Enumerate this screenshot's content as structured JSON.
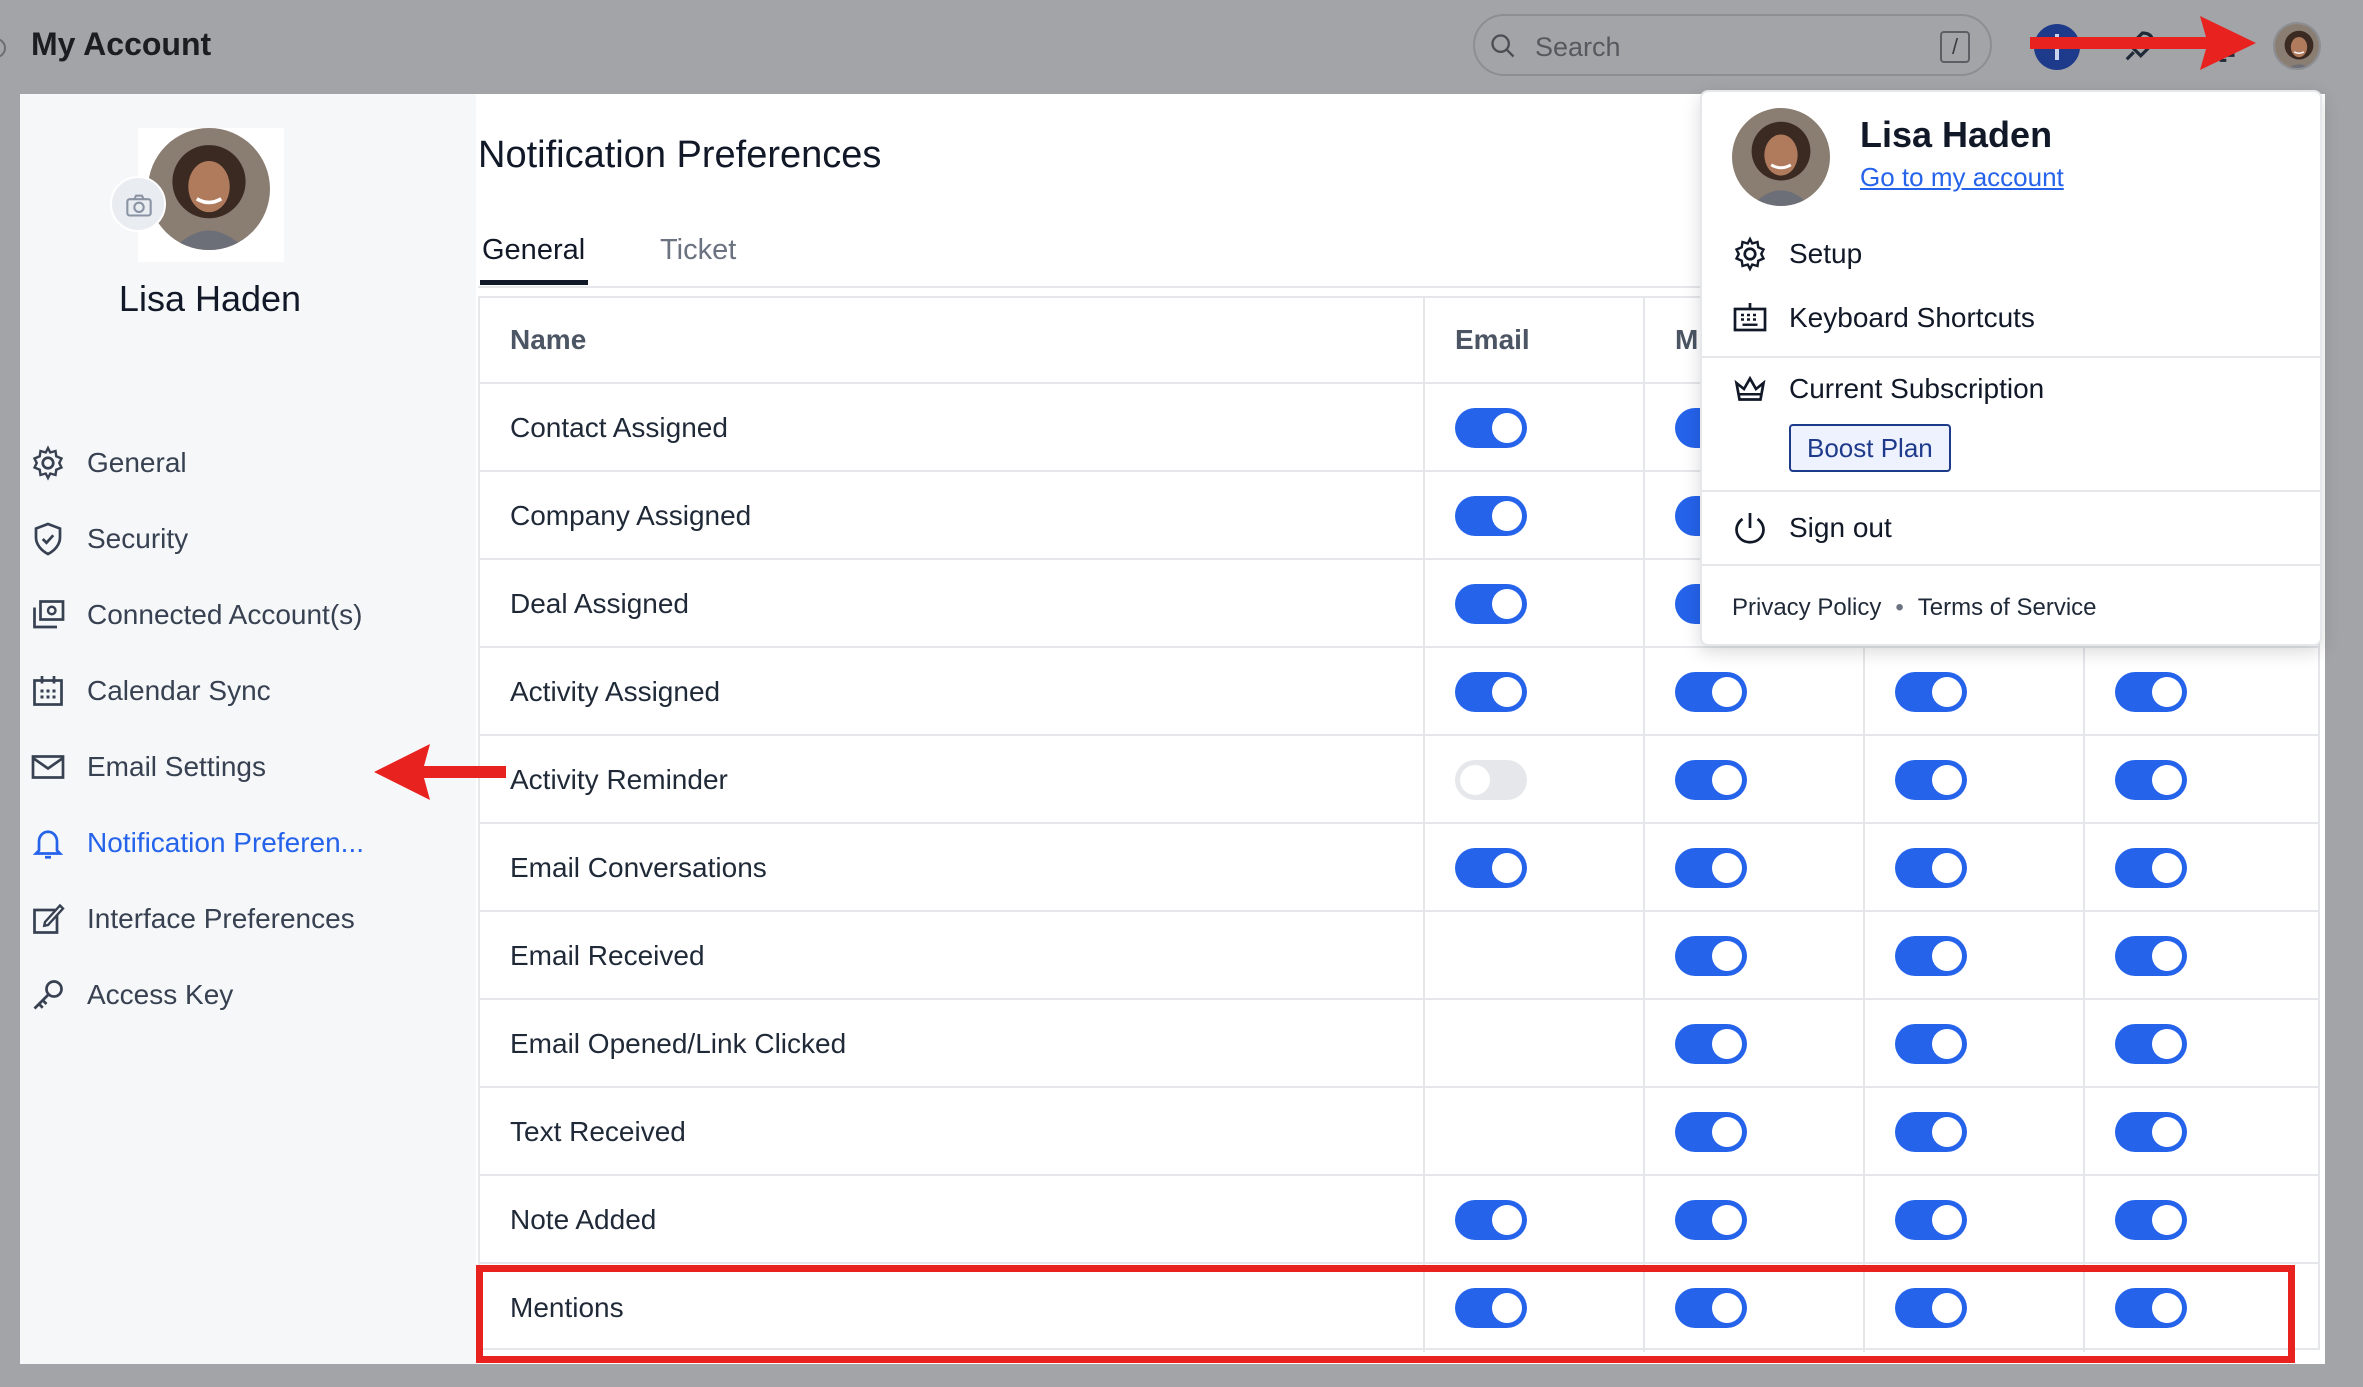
{
  "header": {
    "title": "My Account",
    "search_placeholder": "Search",
    "search_shortcut": "/"
  },
  "profile": {
    "name": "Lisa Haden"
  },
  "sidebar": {
    "items": [
      {
        "label": "General",
        "icon": "gear-icon"
      },
      {
        "label": "Security",
        "icon": "shield-icon"
      },
      {
        "label": "Connected Account(s)",
        "icon": "connected-accounts-icon"
      },
      {
        "label": "Calendar Sync",
        "icon": "calendar-icon"
      },
      {
        "label": "Email Settings",
        "icon": "mail-icon"
      },
      {
        "label": "Notification Preferen...",
        "icon": "bell-icon",
        "active": true
      },
      {
        "label": "Interface Preferences",
        "icon": "edit-icon"
      },
      {
        "label": "Access Key",
        "icon": "key-icon"
      }
    ]
  },
  "main": {
    "title": "Notification Preferences",
    "tabs": [
      {
        "label": "General",
        "active": true
      },
      {
        "label": "Ticket",
        "active": false
      }
    ],
    "table": {
      "columns": [
        "Name",
        "Email",
        "M"
      ],
      "rows": [
        {
          "name": "Contact Assigned",
          "toggles": [
            true,
            true,
            null,
            null
          ]
        },
        {
          "name": "Company Assigned",
          "toggles": [
            true,
            true,
            null,
            null
          ]
        },
        {
          "name": "Deal Assigned",
          "toggles": [
            true,
            true,
            null,
            null
          ]
        },
        {
          "name": "Activity Assigned",
          "toggles": [
            true,
            true,
            true,
            true
          ]
        },
        {
          "name": "Activity Reminder",
          "toggles": [
            false,
            true,
            true,
            true
          ]
        },
        {
          "name": "Email Conversations",
          "toggles": [
            true,
            true,
            true,
            true
          ]
        },
        {
          "name": "Email Received",
          "toggles": [
            null,
            true,
            true,
            true
          ]
        },
        {
          "name": "Email Opened/Link Clicked",
          "toggles": [
            null,
            true,
            true,
            true
          ]
        },
        {
          "name": "Text Received",
          "toggles": [
            null,
            true,
            true,
            true
          ]
        },
        {
          "name": "Note Added",
          "toggles": [
            true,
            true,
            true,
            true
          ]
        },
        {
          "name": "Mentions",
          "toggles": [
            true,
            true,
            true,
            true
          ]
        }
      ]
    }
  },
  "dropdown": {
    "name": "Lisa Haden",
    "account_link": "Go to my account",
    "setup": "Setup",
    "shortcuts": "Keyboard Shortcuts",
    "subscription": "Current Subscription",
    "plan": "Boost Plan",
    "signout": "Sign out",
    "privacy": "Privacy Policy",
    "terms": "Terms of Service"
  },
  "colors": {
    "accent": "#2563eb",
    "annotation": "#e8221f",
    "toggle_off": "#e5e7eb"
  }
}
